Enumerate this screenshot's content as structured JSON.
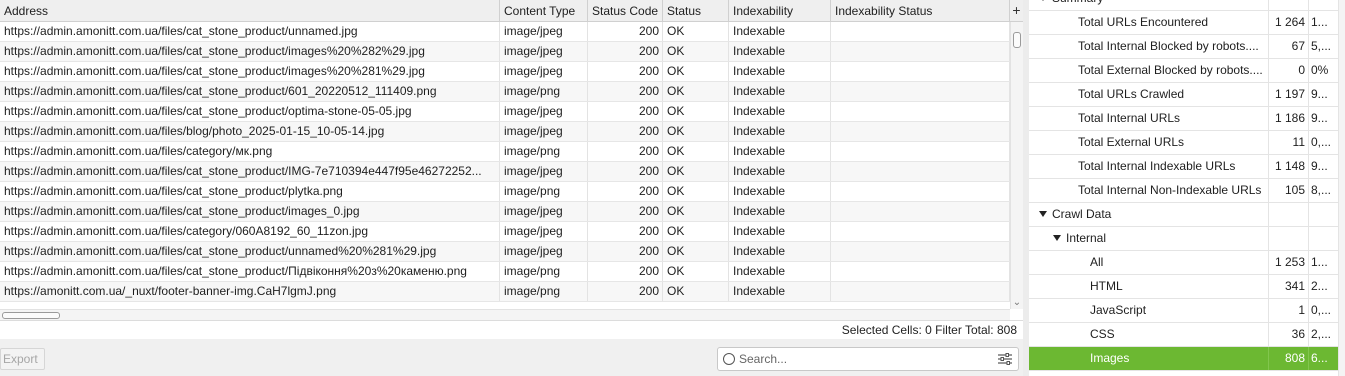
{
  "table": {
    "columns": [
      {
        "key": "address",
        "label": "Address"
      },
      {
        "key": "content_type",
        "label": "Content Type"
      },
      {
        "key": "status_code",
        "label": "Status Code"
      },
      {
        "key": "status",
        "label": "Status"
      },
      {
        "key": "indexability",
        "label": "Indexability"
      },
      {
        "key": "indexability_status",
        "label": "Indexability Status"
      }
    ],
    "add_column": "+",
    "rows": [
      {
        "address": "https://admin.amonitt.com.ua/files/cat_stone_product/unnamed.jpg",
        "content_type": "image/jpeg",
        "status_code": "200",
        "status": "OK",
        "indexability": "Indexable",
        "indexability_status": ""
      },
      {
        "address": "https://admin.amonitt.com.ua/files/cat_stone_product/images%20%282%29.jpg",
        "content_type": "image/jpeg",
        "status_code": "200",
        "status": "OK",
        "indexability": "Indexable",
        "indexability_status": ""
      },
      {
        "address": "https://admin.amonitt.com.ua/files/cat_stone_product/images%20%281%29.jpg",
        "content_type": "image/jpeg",
        "status_code": "200",
        "status": "OK",
        "indexability": "Indexable",
        "indexability_status": ""
      },
      {
        "address": "https://admin.amonitt.com.ua/files/cat_stone_product/601_20220512_111409.png",
        "content_type": "image/png",
        "status_code": "200",
        "status": "OK",
        "indexability": "Indexable",
        "indexability_status": ""
      },
      {
        "address": "https://admin.amonitt.com.ua/files/cat_stone_product/optima-stone-05-05.jpg",
        "content_type": "image/jpeg",
        "status_code": "200",
        "status": "OK",
        "indexability": "Indexable",
        "indexability_status": ""
      },
      {
        "address": "https://admin.amonitt.com.ua/files/blog/photo_2025-01-15_10-05-14.jpg",
        "content_type": "image/jpeg",
        "status_code": "200",
        "status": "OK",
        "indexability": "Indexable",
        "indexability_status": ""
      },
      {
        "address": "https://admin.amonitt.com.ua/files/category/мк.png",
        "content_type": "image/png",
        "status_code": "200",
        "status": "OK",
        "indexability": "Indexable",
        "indexability_status": ""
      },
      {
        "address": "https://admin.amonitt.com.ua/files/cat_stone_product/IMG-7e710394e447f95e46272252...",
        "content_type": "image/jpeg",
        "status_code": "200",
        "status": "OK",
        "indexability": "Indexable",
        "indexability_status": ""
      },
      {
        "address": "https://admin.amonitt.com.ua/files/cat_stone_product/plytka.png",
        "content_type": "image/png",
        "status_code": "200",
        "status": "OK",
        "indexability": "Indexable",
        "indexability_status": ""
      },
      {
        "address": "https://admin.amonitt.com.ua/files/cat_stone_product/images_0.jpg",
        "content_type": "image/jpeg",
        "status_code": "200",
        "status": "OK",
        "indexability": "Indexable",
        "indexability_status": ""
      },
      {
        "address": "https://admin.amonitt.com.ua/files/category/060A8192_60_11zon.jpg",
        "content_type": "image/jpeg",
        "status_code": "200",
        "status": "OK",
        "indexability": "Indexable",
        "indexability_status": ""
      },
      {
        "address": "https://admin.amonitt.com.ua/files/cat_stone_product/unnamed%20%281%29.jpg",
        "content_type": "image/jpeg",
        "status_code": "200",
        "status": "OK",
        "indexability": "Indexable",
        "indexability_status": ""
      },
      {
        "address": "https://admin.amonitt.com.ua/files/cat_stone_product/Підвіконня%20з%20каменю.png",
        "content_type": "image/png",
        "status_code": "200",
        "status": "OK",
        "indexability": "Indexable",
        "indexability_status": ""
      },
      {
        "address": "https://amonitt.com.ua/_nuxt/footer-banner-img.CaH7lgmJ.png",
        "content_type": "image/png",
        "status_code": "200",
        "status": "OK",
        "indexability": "Indexable",
        "indexability_status": ""
      }
    ]
  },
  "statusbar": {
    "selected_cells_label": "Selected Cells:",
    "selected_cells_value": "0",
    "filter_total_label": "Filter Total:",
    "filter_total_value": "808"
  },
  "bottom": {
    "export_label": "Export",
    "search_placeholder": "Search..."
  },
  "panel": {
    "rows": [
      {
        "name": "Summary",
        "count": "",
        "pct": "",
        "level": 0,
        "expander": "expanded"
      },
      {
        "name": "Total URLs Encountered",
        "count": "1 264",
        "pct": "1...",
        "level": 1
      },
      {
        "name": "Total Internal Blocked by robots....",
        "count": "67",
        "pct": "5,...",
        "level": 1
      },
      {
        "name": "Total External Blocked by robots....",
        "count": "0",
        "pct": "0%",
        "level": 1
      },
      {
        "name": "Total URLs Crawled",
        "count": "1 197",
        "pct": "9...",
        "level": 1
      },
      {
        "name": "Total Internal URLs",
        "count": "1 186",
        "pct": "9...",
        "level": 1
      },
      {
        "name": "Total External URLs",
        "count": "11",
        "pct": "0,...",
        "level": 1
      },
      {
        "name": "Total Internal Indexable URLs",
        "count": "1 148",
        "pct": "9...",
        "level": 1
      },
      {
        "name": "Total Internal Non-Indexable URLs",
        "count": "105",
        "pct": "8,...",
        "level": 1
      },
      {
        "name": "Crawl Data",
        "count": "",
        "pct": "",
        "level": 0,
        "expander": "expanded"
      },
      {
        "name": "Internal",
        "count": "",
        "pct": "",
        "level": 1,
        "expander": "expanded"
      },
      {
        "name": "All",
        "count": "1 253",
        "pct": "1...",
        "level": 2
      },
      {
        "name": "HTML",
        "count": "341",
        "pct": "2...",
        "level": 2
      },
      {
        "name": "JavaScript",
        "count": "1",
        "pct": "0,...",
        "level": 2
      },
      {
        "name": "CSS",
        "count": "36",
        "pct": "2,...",
        "level": 2
      },
      {
        "name": "Images",
        "count": "808",
        "pct": "6...",
        "level": 2,
        "selected": true
      }
    ]
  },
  "colors": {
    "selected_row": "#6cb832",
    "header_bg": "#efefef"
  }
}
